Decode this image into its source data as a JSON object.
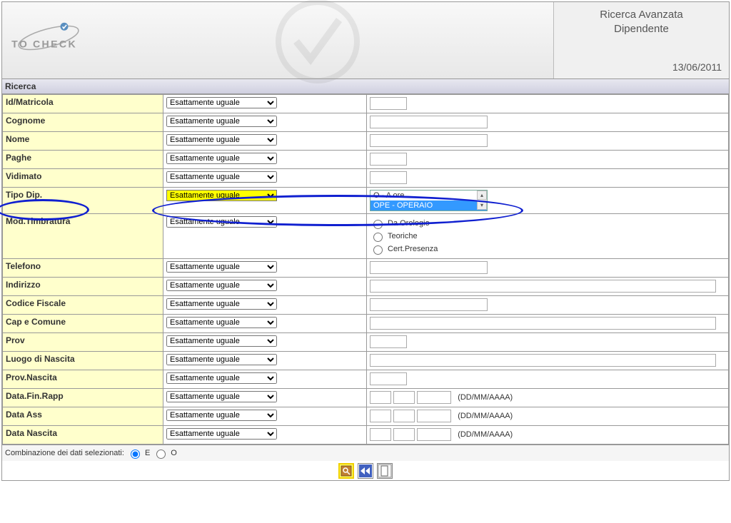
{
  "header": {
    "logo_text_1": "TO",
    "logo_text_2": "CHECK",
    "title_line1": "Ricerca Avanzata",
    "title_line2": "Dipendente",
    "date": "13/06/2011"
  },
  "section_title": "Ricerca",
  "op_default": "Esattamente uguale",
  "rows": {
    "id_matricola": "Id/Matricola",
    "cognome": "Cognome",
    "nome": "Nome",
    "paghe": "Paghe",
    "vidimato": "Vidimato",
    "tipo_dip": "Tipo Dip.",
    "mod_timbratura": "Mod.Timbratura",
    "telefono": "Telefono",
    "indirizzo": "Indirizzo",
    "codice_fiscale": "Codice Fiscale",
    "cap_comune": "Cap e Comune",
    "prov": "Prov",
    "luogo_nascita": "Luogo di Nascita",
    "prov_nascita": "Prov.Nascita",
    "data_fin_rapp": "Data.Fin.Rapp",
    "data_ass": "Data Ass",
    "data_nascita": "Data Nascita"
  },
  "tipo_dip_options": {
    "opt1": "O - A ore",
    "opt2": "OPE - OPERAIO"
  },
  "mod_timbratura_options": {
    "opt1": "Da Orologio",
    "opt2": "Teoriche",
    "opt3": "Cert.Presenza"
  },
  "date_hint": "(DD/MM/AAAA)",
  "footer": {
    "label": "Combinazione dei dati selezionati:",
    "opt_e": "E",
    "opt_o": "O"
  },
  "icons": {
    "search": "search-icon",
    "reset": "reset-icon",
    "new": "new-icon"
  }
}
